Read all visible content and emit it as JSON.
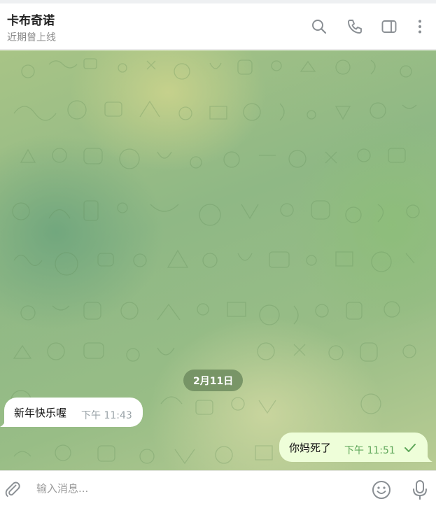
{
  "header": {
    "title": "卡布奇诺",
    "status": "近期曾上线",
    "icons": [
      "search-icon",
      "phone-icon",
      "sidebar-toggle-icon",
      "more-vertical-icon"
    ]
  },
  "chat": {
    "date_separator": "2月11日",
    "messages": [
      {
        "direction": "incoming",
        "text": "新年快乐喔",
        "time": "下午 11:43"
      },
      {
        "direction": "outgoing",
        "text": "你妈死了",
        "time": "下午 11:51",
        "status": "read-check"
      }
    ]
  },
  "composer": {
    "placeholder": "输入消息...",
    "icons": [
      "attach-icon",
      "emoji-icon",
      "microphone-icon"
    ]
  },
  "colors": {
    "outgoing_bubble": "#eefed9",
    "incoming_bubble": "#ffffff",
    "outgoing_time": "#5fa75a",
    "date_pill": "#6e8c5f"
  }
}
